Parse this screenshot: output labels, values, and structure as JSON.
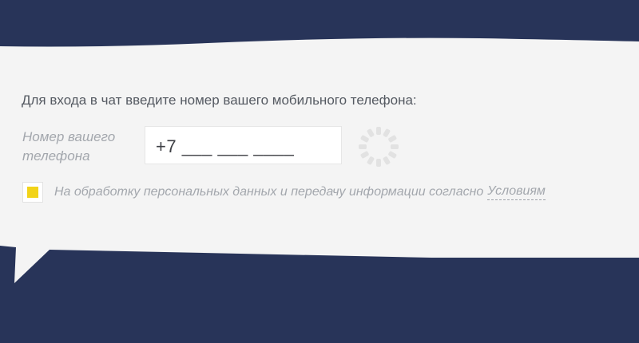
{
  "colors": {
    "background": "#283459",
    "bubble": "#f4f4f4",
    "checkbox_accent": "#f2d318"
  },
  "form": {
    "prompt": "Для входа в чат введите номер вашего мобильного телефона:",
    "phone_label": "Номер вашего телефона",
    "phone_value": "+7 ___ ___ ____",
    "consent_checked": true,
    "consent_text": "На обработку персональных данных и передачу информации согласно",
    "consent_link": "Условиям"
  },
  "icons": {
    "spinner": "loading-spinner-icon",
    "checkbox": "checkbox-checked-icon"
  }
}
